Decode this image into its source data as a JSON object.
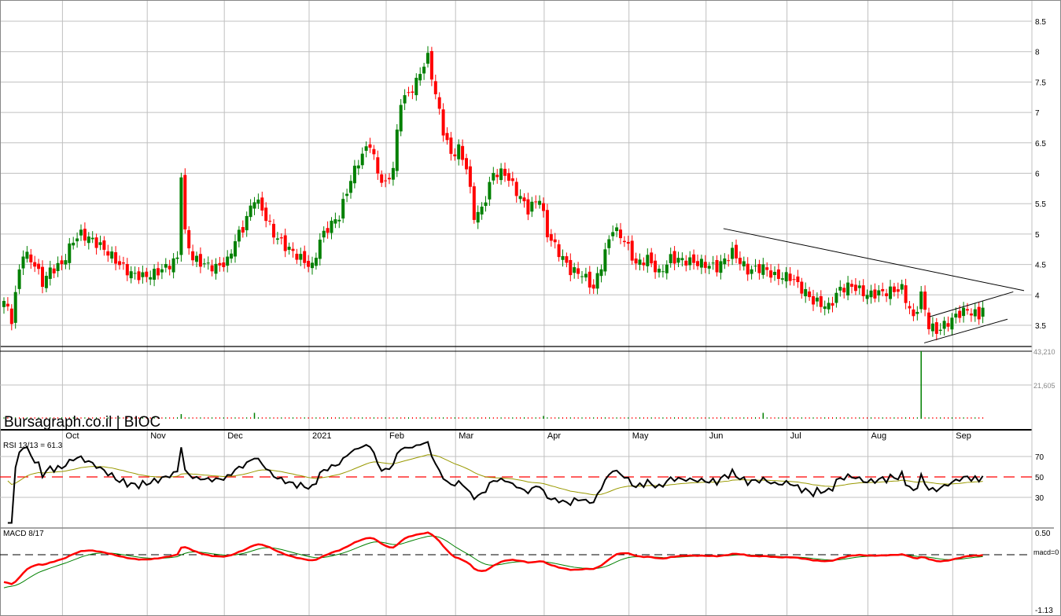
{
  "chart_data": {
    "type": "candlestick",
    "title": "Bursagraph.co.il | BIOC",
    "price_axis": {
      "ticks": [
        "3.5",
        "4",
        "4.5",
        "5",
        "5.5",
        "6",
        "6.5",
        "7",
        "7.5",
        "8",
        "8.5"
      ],
      "range": [
        3.2,
        8.6
      ]
    },
    "volume_axis": {
      "ticks": [
        "43,210",
        "21,605"
      ],
      "max": 43210
    },
    "months": [
      {
        "label": "Oct",
        "day": 16
      },
      {
        "label": "Nov",
        "day": 38
      },
      {
        "label": "Dec",
        "day": 58
      },
      {
        "label": "2021",
        "day": 80
      },
      {
        "label": "Feb",
        "day": 100
      },
      {
        "label": "Mar",
        "day": 118
      },
      {
        "label": "Apr",
        "day": 141
      },
      {
        "label": "May",
        "day": 163
      },
      {
        "label": "Jun",
        "day": 183
      },
      {
        "label": "Jul",
        "day": 204
      },
      {
        "label": "Aug",
        "day": 225
      },
      {
        "label": "Sep",
        "day": 247
      }
    ],
    "close_path": [
      [
        0,
        3.9
      ],
      [
        2,
        3.6
      ],
      [
        4,
        4.4
      ],
      [
        5,
        4.7
      ],
      [
        8,
        4.5
      ],
      [
        10,
        4.2
      ],
      [
        12,
        4.4
      ],
      [
        15,
        4.5
      ],
      [
        18,
        4.9
      ],
      [
        20,
        5.0
      ],
      [
        23,
        4.9
      ],
      [
        27,
        4.7
      ],
      [
        30,
        4.5
      ],
      [
        33,
        4.35
      ],
      [
        36,
        4.3
      ],
      [
        39,
        4.35
      ],
      [
        42,
        4.45
      ],
      [
        45,
        4.6
      ],
      [
        46,
        6.0
      ],
      [
        47,
        5.0
      ],
      [
        49,
        4.6
      ],
      [
        52,
        4.5
      ],
      [
        55,
        4.45
      ],
      [
        58,
        4.55
      ],
      [
        60,
        4.9
      ],
      [
        62,
        5.1
      ],
      [
        65,
        5.6
      ],
      [
        67,
        5.4
      ],
      [
        70,
        5.0
      ],
      [
        73,
        4.8
      ],
      [
        77,
        4.6
      ],
      [
        80,
        4.45
      ],
      [
        82,
        4.9
      ],
      [
        84,
        5.1
      ],
      [
        87,
        5.3
      ],
      [
        90,
        5.9
      ],
      [
        92,
        6.2
      ],
      [
        95,
        6.5
      ],
      [
        97,
        6.0
      ],
      [
        99,
        5.8
      ],
      [
        101,
        6.1
      ],
      [
        103,
        7.2
      ],
      [
        105,
        7.3
      ],
      [
        107,
        7.5
      ],
      [
        109,
        7.8
      ],
      [
        110,
        7.9
      ],
      [
        112,
        7.3
      ],
      [
        114,
        6.7
      ],
      [
        116,
        6.3
      ],
      [
        118,
        6.4
      ],
      [
        120,
        6.1
      ],
      [
        122,
        5.3
      ],
      [
        124,
        5.4
      ],
      [
        127,
        6.0
      ],
      [
        130,
        6.0
      ],
      [
        133,
        5.7
      ],
      [
        136,
        5.4
      ],
      [
        139,
        5.6
      ],
      [
        141,
        5.0
      ],
      [
        144,
        4.7
      ],
      [
        147,
        4.4
      ],
      [
        150,
        4.35
      ],
      [
        153,
        4.1
      ],
      [
        156,
        4.7
      ],
      [
        158,
        5.1
      ],
      [
        161,
        4.9
      ],
      [
        164,
        4.5
      ],
      [
        167,
        4.6
      ],
      [
        170,
        4.35
      ],
      [
        173,
        4.6
      ],
      [
        178,
        4.55
      ],
      [
        182,
        4.5
      ],
      [
        185,
        4.45
      ],
      [
        189,
        4.7
      ],
      [
        193,
        4.4
      ],
      [
        197,
        4.45
      ],
      [
        200,
        4.3
      ],
      [
        204,
        4.3
      ],
      [
        207,
        4.1
      ],
      [
        210,
        3.9
      ],
      [
        214,
        3.8
      ],
      [
        217,
        4.1
      ],
      [
        220,
        4.15
      ],
      [
        224,
        4.0
      ],
      [
        229,
        4.05
      ],
      [
        233,
        4.1
      ],
      [
        236,
        3.6
      ],
      [
        238,
        4.0
      ],
      [
        240,
        3.5
      ],
      [
        242,
        3.4
      ],
      [
        245,
        3.55
      ],
      [
        248,
        3.7
      ],
      [
        250,
        3.75
      ],
      [
        253,
        3.65
      ],
      [
        254,
        3.8
      ]
    ],
    "volume_spikes": [
      [
        46,
        3000
      ],
      [
        65,
        3800
      ],
      [
        140,
        1800
      ],
      [
        197,
        3800
      ],
      [
        238,
        43210
      ]
    ],
    "trendlines": [
      {
        "from": [
          186.7,
          5.09
        ],
        "to": [
          264.7,
          4.07
        ]
      },
      {
        "from": [
          240.2,
          3.64
        ],
        "to": [
          261.9,
          4.05
        ]
      },
      {
        "from": [
          238.8,
          3.21
        ],
        "to": [
          260.4,
          3.6
        ]
      }
    ],
    "rsi": {
      "label": "RSI 13/13 = 61.3",
      "levels": [
        "70",
        "50",
        "30"
      ]
    },
    "macd": {
      "label": "MACD 8/17",
      "top": "0.50",
      "zero": "macd=0",
      "bottom": "-1.13"
    },
    "colors": {
      "up": "#008000",
      "down": "#ff0000",
      "rsi": "#000000",
      "rsi_signal": "#999900",
      "macd": "#ff0000",
      "macd_signal": "#008000"
    }
  }
}
